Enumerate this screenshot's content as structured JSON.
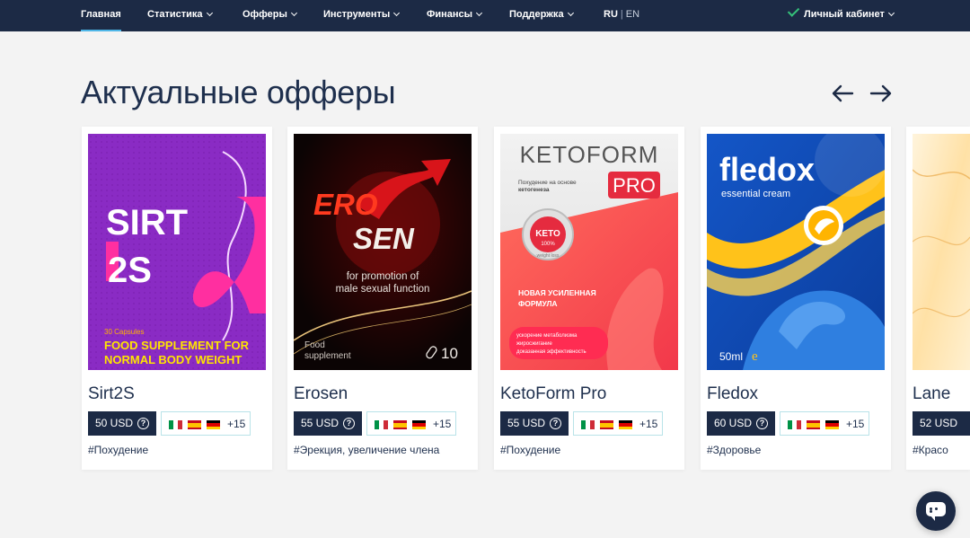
{
  "nav": {
    "items": [
      {
        "label": "Главная",
        "active": true,
        "dropdown": false
      },
      {
        "label": "Статистика",
        "active": false,
        "dropdown": true
      },
      {
        "label": "Офферы",
        "active": false,
        "dropdown": true
      },
      {
        "label": "Инструменты",
        "active": false,
        "dropdown": true
      },
      {
        "label": "Финансы",
        "active": false,
        "dropdown": true
      },
      {
        "label": "Поддержка",
        "active": false,
        "dropdown": true
      }
    ],
    "lang_ru": "RU",
    "lang_sep": "|",
    "lang_en": "EN",
    "account_label": "Личный кабинет"
  },
  "page": {
    "title": "Актуальные офферы",
    "prev_icon": "arrow-left-icon",
    "next_icon": "arrow-right-icon"
  },
  "offers": [
    {
      "name": "Sirt2S",
      "price": "50 USD",
      "geo_more": "+15",
      "tag": "#Похудение",
      "image_text": {
        "line1": "SIRT",
        "line2": "2S",
        "caps": "30 Capsules",
        "bottom1": "FOOD SUPPLEMENT FOR",
        "bottom2": "NORMAL BODY WEIGHT"
      }
    },
    {
      "name": "Erosen",
      "price": "55 USD",
      "geo_more": "+15",
      "tag": "#Эрекция, увеличение члена",
      "image_text": {
        "line1": "ERO",
        "line2": "SEN",
        "sub1": "for promotion of",
        "sub2": "male sexual function",
        "food1": "Food",
        "food2": "supplement",
        "count": "10"
      }
    },
    {
      "name": "KetoForm Pro",
      "price": "55 USD",
      "geo_more": "+15",
      "tag": "#Похудение",
      "image_text": {
        "brand": "KETOFORM",
        "pro": "PRO",
        "sub1": "Похудение на основе",
        "sub2": "кетогенеза",
        "keto": "KETO",
        "pct": "100%",
        "wl": "weight loss",
        "new1": "НОВАЯ УСИЛЕННАЯ",
        "new2": "ФОРМУЛА",
        "b1": "ускорение метаболизма",
        "b2": "жиросжигание",
        "b3": "доказанная эффективность"
      }
    },
    {
      "name": "Fledox",
      "price": "60 USD",
      "geo_more": "+15",
      "tag": "#Здоровье",
      "image_text": {
        "brand": "fledox",
        "sub": "essential cream",
        "vol": "50ml"
      }
    },
    {
      "name": "Lane",
      "price": "52 USD",
      "geo_more": "",
      "tag": "#Красо",
      "image_text": {}
    }
  ],
  "flags": [
    "italy-flag",
    "spain-flag",
    "germany-flag"
  ],
  "colors": {
    "nav_bg": "#1c2a45",
    "accent": "#4fb7e8",
    "check": "#35c17a",
    "page_bg": "#f3f3f3",
    "text": "#1e2f4d"
  },
  "chat": {
    "icon": "chat-icon"
  }
}
